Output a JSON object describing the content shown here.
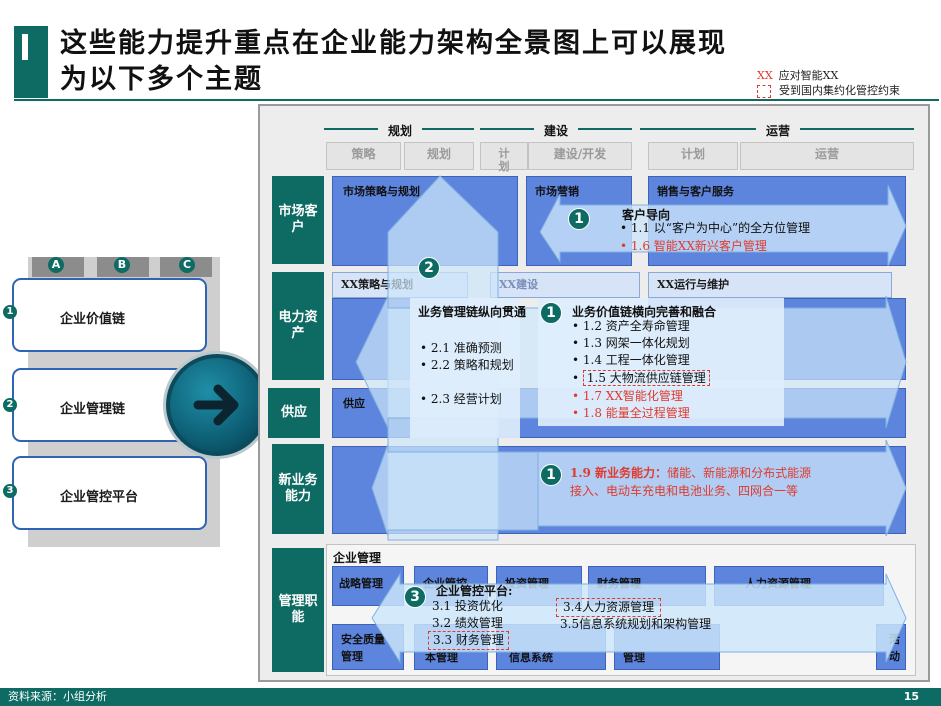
{
  "header": {
    "title_line1": "这些能力提升重点在企业能力架构全景图上可以展现",
    "title_line2": "为以下多个主题",
    "legend_xx": "XX",
    "legend_xx_text": "应对智能XX",
    "legend_box_text": "受到国内集约化管控约束"
  },
  "chain": {
    "columns": [
      "A",
      "B",
      "C"
    ],
    "items": [
      {
        "num": "1",
        "label": "企业价值链"
      },
      {
        "num": "2",
        "label": "企业管理链"
      },
      {
        "num": "3",
        "label": "企业管控平台"
      }
    ]
  },
  "phases": {
    "plan": "规划",
    "build": "建设",
    "operate": "运营",
    "subs": [
      "策略",
      "规划",
      "计划",
      "建设/开发",
      "计划",
      "运营"
    ]
  },
  "rows": {
    "market": "市场客户",
    "power": "电力资产",
    "supply": "供应",
    "new_business": "新业务能力",
    "management": "管理职能"
  },
  "cells": {
    "market_strategy": "市场策略与规划",
    "market_marketing": "市场营销",
    "sales_service": "销售与客户服务",
    "xx_strategy": "XX策略与规划",
    "xx_build": "XX建设",
    "xx_operate": "XX运行与维护",
    "supply": "供应",
    "enterprise_mgmt": "企业管理",
    "strategy_mgmt": "战略管理",
    "enterprise_ctrl": "企业管控",
    "investment_mgmt": "投资管理",
    "finance_mgmt": "财务管理",
    "hr_mgmt": "人力资源管理",
    "safety_quality": "安全质量管理",
    "cost_mgmt": "本管理",
    "info_system": "信息系统",
    "mgmt": "管理",
    "activity": "活动"
  },
  "themes": {
    "customer": {
      "num": "1",
      "title": "客户导向",
      "b1": "1.1 以“客户为中心”的全方位管理",
      "b2": "1.6 智能XX新兴客户管理"
    },
    "vertical": {
      "num": "2",
      "title": "业务管理链纵向贯通",
      "items": [
        "2.1 准确预测",
        "2.2 策略和规划",
        "2.3 经营计划"
      ]
    },
    "horizontal": {
      "num": "1",
      "title": "业务价值链横向完善和融合",
      "items": [
        "1.2 资产全寿命管理",
        "1.3 网架一体化规划",
        "1.4 工程一体化管理",
        "1.5 大物流供应链管理"
      ],
      "red_items": [
        "1.7 XX智能化管理",
        "1.8 能量全过程管理"
      ]
    },
    "new_business": {
      "num": "1",
      "lead": "1.9 新业务能力：",
      "text": "储能、新能源和分布式能源接入、电动车充电和电池业务、四网合一等"
    },
    "platform": {
      "num": "3",
      "title": "企业管控平台:",
      "left": [
        "3.1 投资优化",
        "3.2 绩效管理",
        "3.3 财务管理"
      ],
      "right": [
        "3.4人力资源管理",
        "3.5信息系统规划和架构管理"
      ]
    }
  },
  "footer": {
    "source": "资料来源：小组分析",
    "page": "15"
  },
  "colors": {
    "teal": "#0d6b63",
    "blue": "#5d85de",
    "red": "#e03a2e"
  }
}
